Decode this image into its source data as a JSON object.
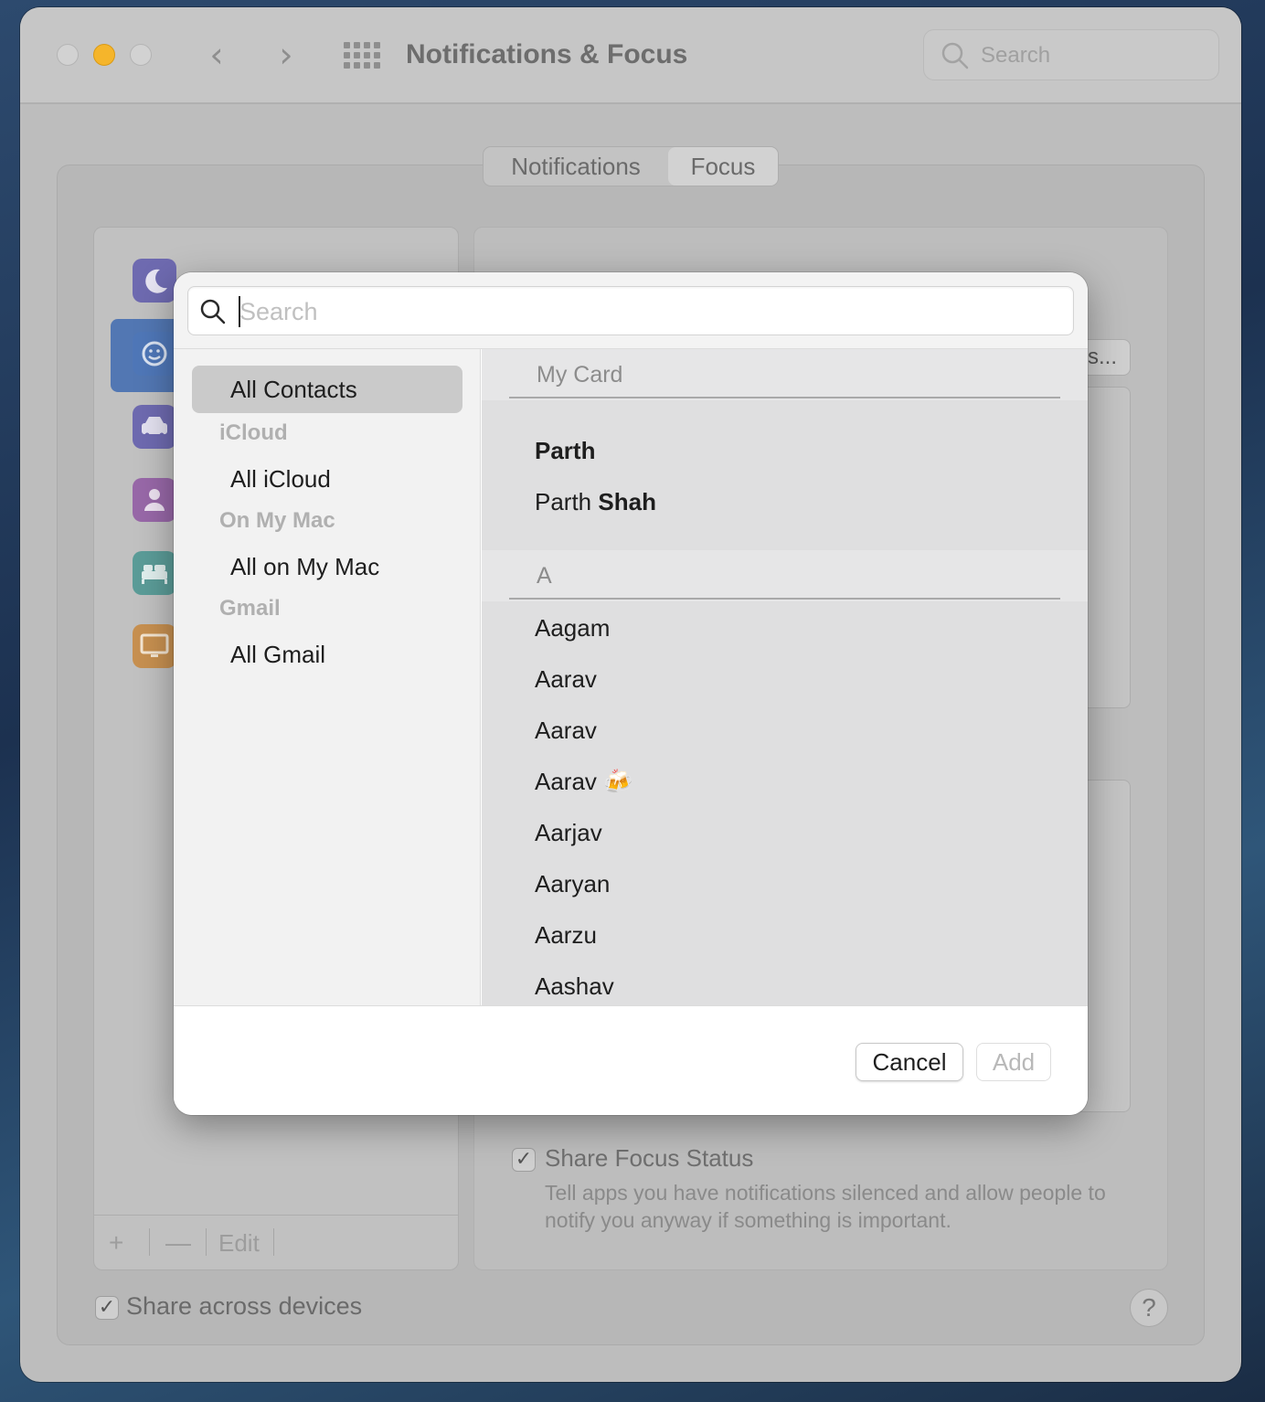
{
  "window": {
    "title": "Notifications & Focus",
    "search_placeholder": "Search"
  },
  "tabs": [
    {
      "label": "Notifications",
      "selected": false
    },
    {
      "label": "Focus",
      "selected": true
    }
  ],
  "focus_list": {
    "items": [
      {
        "icon": "moon-icon",
        "color": "#6e6ab0"
      },
      {
        "icon": "smiley-icon",
        "color": "#4f77b8"
      },
      {
        "icon": "car-icon",
        "color": "#6e6ab0"
      },
      {
        "icon": "person-icon",
        "color": "#9868a8"
      },
      {
        "icon": "bed-icon",
        "color": "#5b9c98"
      },
      {
        "icon": "monitor-icon",
        "color": "#c79050"
      }
    ],
    "toolbar": {
      "add": "+",
      "remove": "—",
      "edit": "Edit"
    }
  },
  "right_panel": {
    "partial_button_text": "s...",
    "share_focus_status": {
      "checked": true,
      "label": "Share Focus Status",
      "description": "Tell apps you have notifications silenced and allow people to notify you anyway if something is important."
    }
  },
  "share_across_devices": {
    "checked": true,
    "label": "Share across devices"
  },
  "help": "?",
  "contact_picker": {
    "search_placeholder": "Search",
    "groups": {
      "all_contacts": "All Contacts",
      "icloud_header": "iCloud",
      "all_icloud": "All iCloud",
      "on_my_mac_header": "On My Mac",
      "all_on_my_mac": "All on My Mac",
      "gmail_header": "Gmail",
      "all_gmail": "All Gmail"
    },
    "my_card_header": "My Card",
    "my_card": [
      {
        "first": "Parth",
        "last": ""
      },
      {
        "first": "Parth",
        "last": "Shah"
      }
    ],
    "section_a_header": "A",
    "section_a": [
      "Aagam",
      "Aarav",
      "Aarav",
      "Aarav 🍻",
      "Aarjav",
      "Aaryan",
      "Aarzu",
      "Aashav"
    ],
    "buttons": {
      "cancel": "Cancel",
      "add": "Add"
    }
  }
}
